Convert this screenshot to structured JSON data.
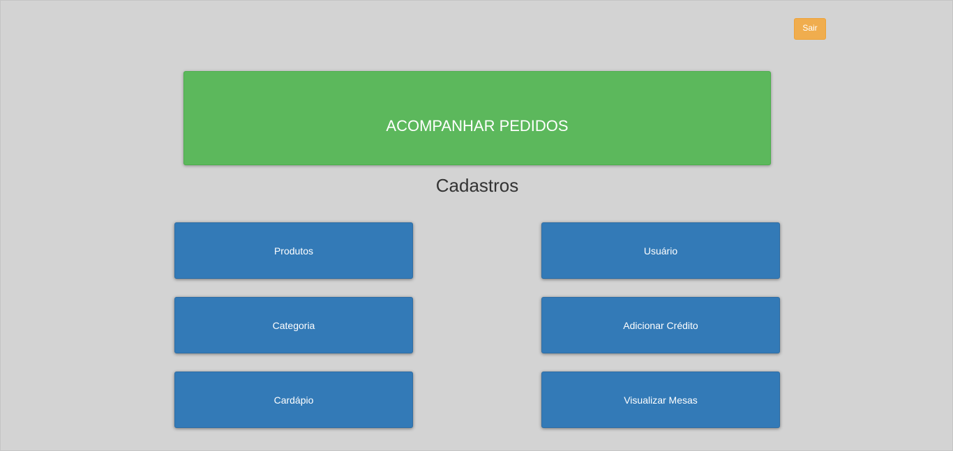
{
  "header": {
    "logout_label": "Sair"
  },
  "main": {
    "track_orders_label": "ACOMPANHAR PEDIDOS",
    "section_title": "Cadastros",
    "buttons": {
      "products": "Produtos",
      "user": "Usuário",
      "category": "Categoria",
      "add_credit": "Adicionar Crédito",
      "menu": "Cardápio",
      "view_tables": "Visualizar Mesas"
    }
  },
  "colors": {
    "background": "#d3d3d3",
    "logout": "#f0ad4e",
    "track_orders": "#5cb85c",
    "register_buttons": "#337ab7"
  }
}
